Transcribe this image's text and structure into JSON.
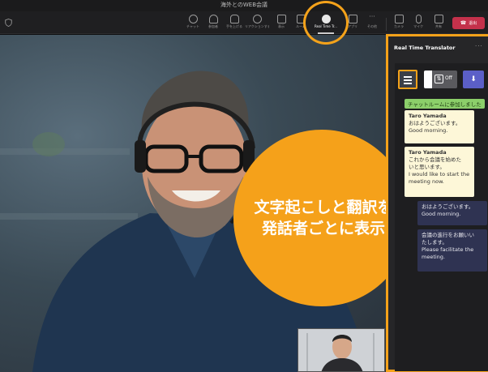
{
  "window": {
    "title": "海外とのWEB会議"
  },
  "toolbar": {
    "items": [
      {
        "label": "チャット",
        "icon": "chat-icon"
      },
      {
        "label": "参加者",
        "icon": "people-icon"
      },
      {
        "label": "手を上げる",
        "icon": "raise-hand-icon"
      },
      {
        "label": "リアクションする",
        "icon": "reaction-icon"
      },
      {
        "label": "表示",
        "icon": "view-icon"
      },
      {
        "label": "ルーム",
        "icon": "rooms-icon"
      },
      {
        "label": "Real Time Tr...",
        "icon": "real-time-translator-icon"
      },
      {
        "label": "アプリ",
        "icon": "apps-icon"
      },
      {
        "label": "その他",
        "icon": "more-icon"
      },
      {
        "label": "カメラ",
        "icon": "camera-icon"
      },
      {
        "label": "マイク",
        "icon": "mic-icon"
      },
      {
        "label": "共有",
        "icon": "share-icon"
      }
    ],
    "leave_label": "退出"
  },
  "callout": {
    "line1": "文字起こしと翻訳を",
    "line2": "発話者ごとに表示"
  },
  "panel": {
    "title": "Real Time Translator",
    "more": "···",
    "toggle_label": "Off",
    "system_message": "チャットルームに参加しました",
    "messages": [
      {
        "speaker": "Taro Yamada",
        "original": [
          "おはようございます。"
        ],
        "translation": [
          "Good morning."
        ]
      },
      {
        "speaker": "Taro Yamada",
        "original": [
          "これから会議を始めた",
          "いと思います。"
        ],
        "translation": [
          "I would like to start the",
          "meeting now."
        ]
      },
      {
        "original": [
          "おはようございます。"
        ],
        "translation": [
          "Good morning."
        ]
      },
      {
        "original": [
          "会議の進行をお願いい",
          "たします。"
        ],
        "translation": [
          "Please facilitate the",
          "meeting."
        ]
      }
    ]
  },
  "colors": {
    "accent": "#f4a21a",
    "leave": "#c4314b",
    "cream_bubble": "#fdf7d8",
    "dark_bubble": "#2f3352",
    "system_green": "#8ccf6a"
  }
}
